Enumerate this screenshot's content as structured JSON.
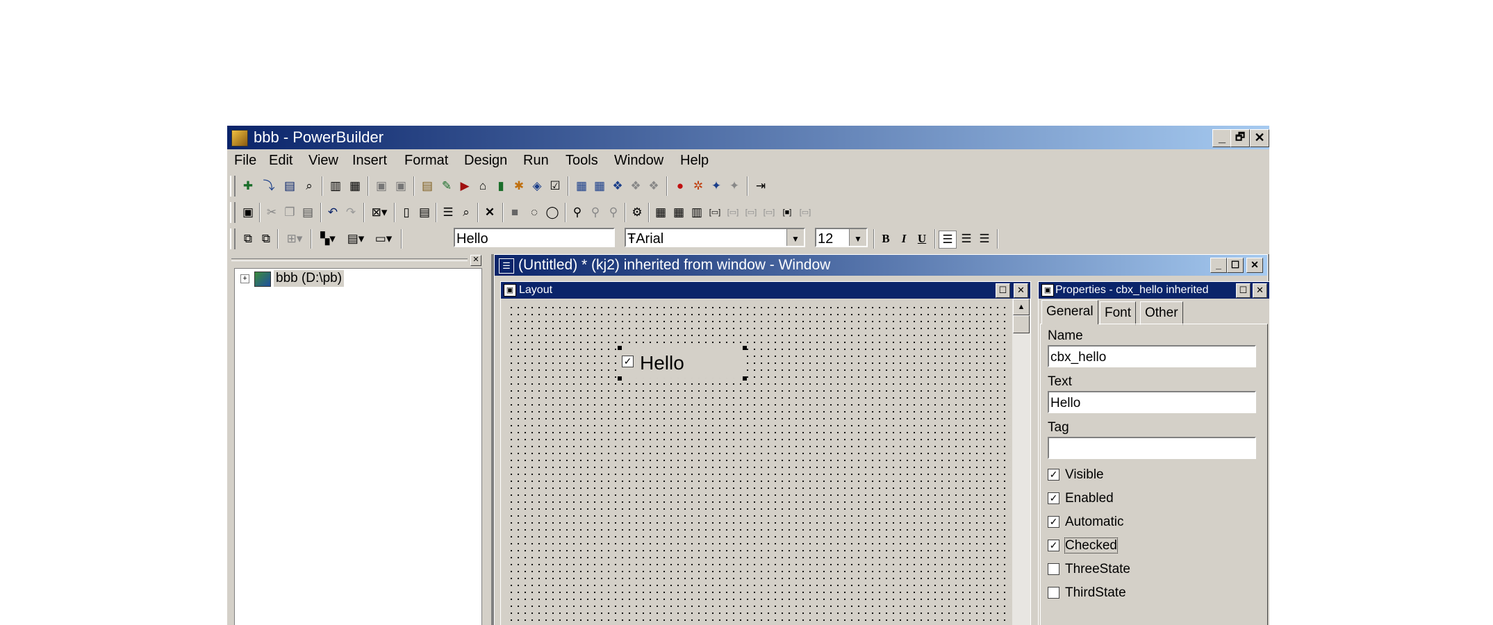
{
  "app": {
    "title": "bbb - PowerBuilder"
  },
  "title_buttons": {
    "minimize": "_",
    "restore": "🗗",
    "close": "✕"
  },
  "menu": [
    "File",
    "Edit",
    "View",
    "Insert",
    "Format",
    "Design",
    "Run",
    "Tools",
    "Window",
    "Help"
  ],
  "stylebar": {
    "text_value": "Hello",
    "font_value": "Arial",
    "font_prefix": "Ŧ",
    "size_value": "12",
    "bold": "B",
    "italic": "I",
    "underline": "U"
  },
  "tree": {
    "root_label": "bbb (D:\\pb)",
    "expander": "+"
  },
  "child_window": {
    "title": "(Untitled) * (kj2) inherited from window - Window"
  },
  "layout_pane": {
    "title": "Layout"
  },
  "canvas": {
    "checkbox_text": "Hello",
    "checkbox_checked": true
  },
  "properties_pane": {
    "title": "Properties - cbx_hello inherited",
    "tabs": [
      "General",
      "Font",
      "Other"
    ],
    "name_label": "Name",
    "name_value": "cbx_hello",
    "text_label": "Text",
    "text_value": "Hello",
    "tag_label": "Tag",
    "tag_value": "",
    "checkboxes": [
      {
        "label": "Visible",
        "checked": true
      },
      {
        "label": "Enabled",
        "checked": true
      },
      {
        "label": "Automatic",
        "checked": true
      },
      {
        "label": "Checked",
        "checked": true
      },
      {
        "label": "ThreeState",
        "checked": false
      },
      {
        "label": "ThirdState",
        "checked": false
      }
    ]
  },
  "colors": {
    "title_start": "#0a246a",
    "title_end": "#a6caf0",
    "face": "#d4d0c8"
  }
}
